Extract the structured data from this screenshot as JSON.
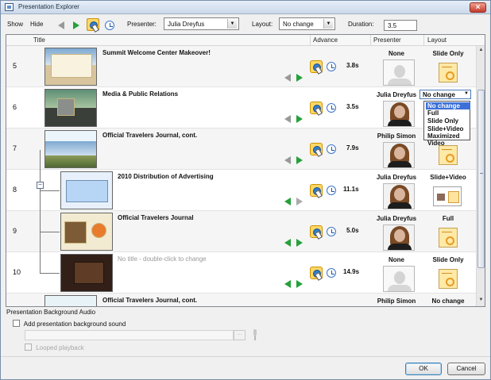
{
  "window": {
    "title": "Presentation Explorer",
    "close_label": "×"
  },
  "toolbar": {
    "show_label": "Show",
    "hide_label": "Hide",
    "presenter_label": "Presenter:",
    "presenter_value": "Julia Dreyfus",
    "layout_label": "Layout:",
    "layout_value": "No change",
    "duration_label": "Duration:",
    "duration_value": "3.5"
  },
  "columns": {
    "title": "Title",
    "advance": "Advance",
    "presenter": "Presenter",
    "layout": "Layout"
  },
  "slides": [
    {
      "number": "5",
      "title": "Summit Welcome Center Makeover!",
      "duration": "3.8s",
      "presenter": "None",
      "layout": "Slide Only",
      "prev_enabled": false,
      "next_enabled": true
    },
    {
      "number": "6",
      "title": "Media & Public Relations",
      "duration": "3.5s",
      "presenter": "Julia Dreyfus",
      "layout": "No change",
      "prev_enabled": false,
      "next_enabled": true
    },
    {
      "number": "7",
      "title": "Official Travelers Journal, cont.",
      "duration": "7.9s",
      "presenter": "Philip Simon",
      "layout": "",
      "prev_enabled": false,
      "next_enabled": true
    },
    {
      "number": "8",
      "title": "2010 Distribution of Advertising",
      "duration": "11.1s",
      "presenter": "Julia Dreyfus",
      "layout": "Slide+Video",
      "prev_enabled": true,
      "next_enabled": false
    },
    {
      "number": "9",
      "title": "Official Travelers Journal",
      "duration": "5.0s",
      "presenter": "Julia Dreyfus",
      "layout": "Full",
      "prev_enabled": true,
      "next_enabled": true
    },
    {
      "number": "10",
      "title": "No title - double-click to change",
      "duration": "14.9s",
      "presenter": "None",
      "layout": "Slide Only",
      "prev_enabled": true,
      "next_enabled": true
    },
    {
      "number": "",
      "title": "Official Travelers Journal, cont.",
      "duration": "",
      "presenter": "Philip Simon",
      "layout": "No change",
      "prev_enabled": false,
      "next_enabled": false
    }
  ],
  "layout_menu": {
    "selected": "No change",
    "options": [
      "No change",
      "Full",
      "Slide Only",
      "Slide+Video",
      "Maximized Video"
    ]
  },
  "audio": {
    "section_title": "Presentation Background Audio",
    "add_label": "Add presentation background sound",
    "browse_label": "...",
    "looped_label": "Looped playback"
  },
  "buttons": {
    "ok": "OK",
    "cancel": "Cancel"
  },
  "icons": {
    "advance_click": "advance-click-icon",
    "advance_timer": "timer-icon",
    "presenter_photo": "presenter-photo",
    "slide_only_layout": "slide-only-layout-icon",
    "slide_video_layout": "slide-video-layout-icon"
  }
}
